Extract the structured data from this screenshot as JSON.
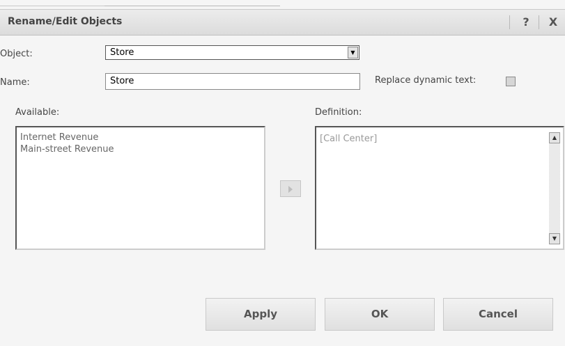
{
  "dialog": {
    "title": "Rename/Edit Objects",
    "help_label": "?",
    "close_label": "X"
  },
  "object": {
    "label": "Object:",
    "selected": "Store"
  },
  "name": {
    "label": "Name:",
    "value": "Store"
  },
  "replace_dynamic": {
    "label": "Replace dynamic text:",
    "checked": false
  },
  "available": {
    "label": "Available:",
    "items": [
      "Internet Revenue",
      "Main-street Revenue"
    ]
  },
  "definition": {
    "label": "Definition:",
    "items": [
      "[Call Center]"
    ]
  },
  "buttons": {
    "apply": "Apply",
    "ok": "OK",
    "cancel": "Cancel"
  },
  "icons": {
    "move": "right-arrow-icon",
    "dropdown": "chevron-down-icon",
    "scroll_up": "scroll-up-icon",
    "scroll_down": "scroll-down-icon"
  }
}
